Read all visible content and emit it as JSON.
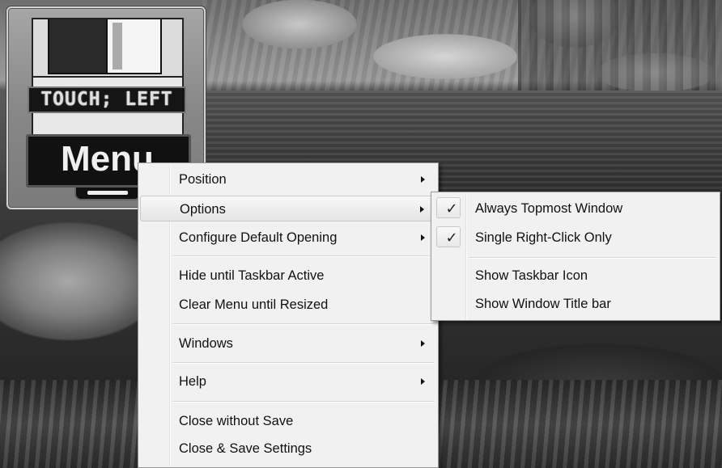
{
  "gadget": {
    "touch_label": "TOUCH; LEFT",
    "menu_button_label": "Menu"
  },
  "context_menu": {
    "items": [
      {
        "label": "Position",
        "submenu": true
      },
      {
        "label": "Options",
        "submenu": true,
        "highlighted": true
      },
      {
        "label": "Configure Default Opening",
        "submenu": true
      },
      {
        "label": "Hide until Taskbar Active",
        "submenu": false
      },
      {
        "label": "Clear Menu until Resized",
        "submenu": false
      },
      {
        "label": "Windows",
        "submenu": true
      },
      {
        "label": "Help",
        "submenu": true
      },
      {
        "label": "Close without Save",
        "submenu": false
      },
      {
        "label": "Close & Save Settings",
        "submenu": false
      }
    ]
  },
  "options_submenu": {
    "items": [
      {
        "label": "Always Topmost Window",
        "checked": true
      },
      {
        "label": "Single Right-Click Only",
        "checked": true
      },
      {
        "label": "Show Taskbar Icon",
        "checked": false
      },
      {
        "label": "Show Window Title bar",
        "checked": false
      }
    ],
    "check_glyph": "✓"
  }
}
